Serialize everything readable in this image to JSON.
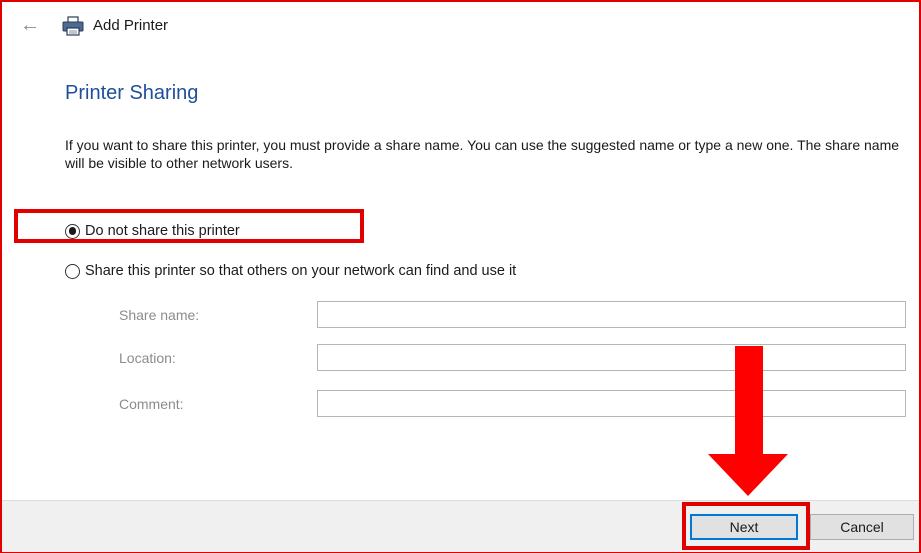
{
  "window": {
    "title": "Add Printer",
    "back_icon": "back-arrow-icon",
    "printer_icon": "printer-icon"
  },
  "page": {
    "heading": "Printer Sharing",
    "description": "If you want to share this printer, you must provide a share name. You can use the suggested name or type a new one. The share name will be visible to other network users."
  },
  "options": [
    {
      "label": "Do not share this printer",
      "selected": true
    },
    {
      "label": "Share this printer so that others on your network can find and use it",
      "selected": false
    }
  ],
  "fields": [
    {
      "label": "Share name:",
      "value": ""
    },
    {
      "label": "Location:",
      "value": ""
    },
    {
      "label": "Comment:",
      "value": ""
    }
  ],
  "buttons": {
    "next": "Next",
    "cancel": "Cancel"
  },
  "annotations": {
    "highlight_color": "#e00000",
    "arrow_color": "#ff0000"
  }
}
